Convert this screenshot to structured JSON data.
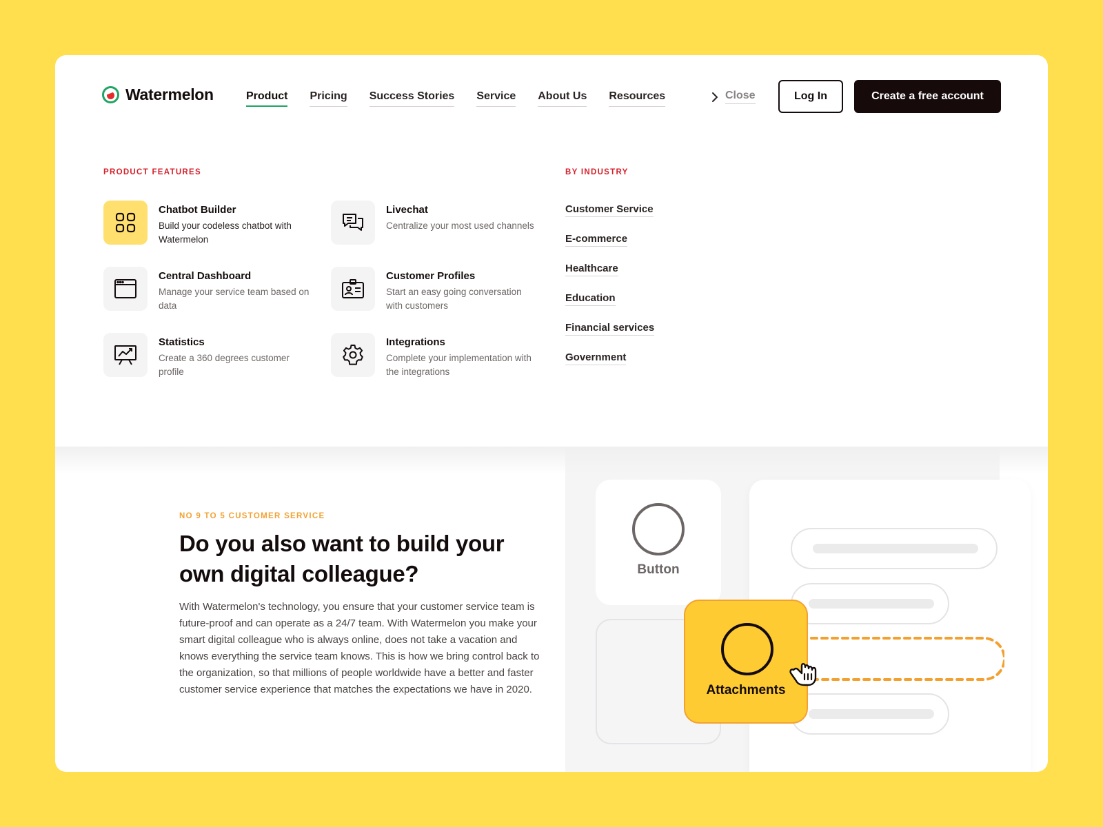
{
  "brand": {
    "name": "Watermelon"
  },
  "nav": {
    "items": [
      {
        "label": "Product"
      },
      {
        "label": "Pricing"
      },
      {
        "label": "Success Stories"
      },
      {
        "label": "Service"
      },
      {
        "label": "About Us"
      },
      {
        "label": "Resources"
      }
    ],
    "close_label": "Close",
    "login_label": "Log In",
    "create_label": "Create a free account"
  },
  "menu": {
    "features_heading": "PRODUCT FEATURES",
    "features": [
      {
        "title": "Chatbot Builder",
        "desc": "Build your codeless chatbot with Watermelon",
        "icon": "grid-icon"
      },
      {
        "title": "Livechat",
        "desc": "Centralize your most used channels",
        "icon": "chat-bubbles-icon"
      },
      {
        "title": "Central Dashboard",
        "desc": "Manage your service team based on data",
        "icon": "browser-window-icon"
      },
      {
        "title": "Customer Profiles",
        "desc": "Start an easy going conversation with customers",
        "icon": "id-card-icon"
      },
      {
        "title": "Statistics",
        "desc": "Create a 360 degrees customer profile",
        "icon": "presentation-chart-icon"
      },
      {
        "title": "Integrations",
        "desc": "Complete your implementation with the integrations",
        "icon": "gear-icon"
      }
    ],
    "industry_heading": "BY INDUSTRY",
    "industries": [
      "Customer Service",
      "E-commerce",
      "Healthcare",
      "Education",
      "Financial services",
      "Government"
    ]
  },
  "hero": {
    "eyebrow": "NO 9 TO 5 CUSTOMER SERVICE",
    "headline": "Do you also want to build your own digital colleague?",
    "body": "With Watermelon's technology, you ensure that your customer service team is future-proof and can operate as a 24/7 team. With Watermelon you make your smart digital colleague who is always online, does not take a vacation and knows everything the service team knows. This is how we bring control back to the organization, so that millions of people worldwide have a better and faster customer service experience that matches the expectations we have in 2020."
  },
  "illustration": {
    "button_label": "Button",
    "attachments_label": "Attachments"
  },
  "colors": {
    "background": "#FFDF4E",
    "accent_green": "#1fa463",
    "accent_red": "#d4202a",
    "accent_orange": "#f2a131",
    "accent_yellow": "#FFCB32",
    "dark": "#160a0a"
  }
}
